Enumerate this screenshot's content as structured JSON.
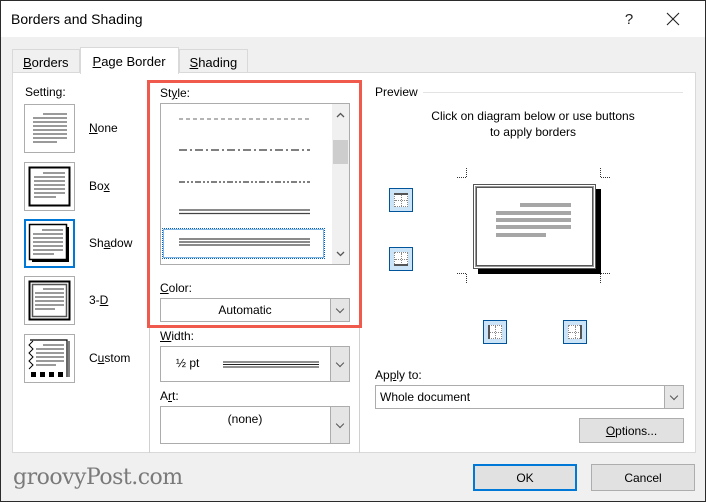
{
  "window": {
    "title": "Borders and Shading",
    "help_label": "?",
    "close_label": "✕"
  },
  "tabs": [
    {
      "label": "Borders",
      "accel": "B",
      "rest": "orders",
      "active": false
    },
    {
      "label": "Page Border",
      "accel": "P",
      "rest": "age Border",
      "active": true
    },
    {
      "label": "Shading",
      "accel": "S",
      "rest": "hading",
      "active": false
    }
  ],
  "setting": {
    "label": "Setting:",
    "items": [
      {
        "label": "None",
        "pre": "",
        "accel": "N",
        "post": "one",
        "selected": false,
        "icon": "page-no-border-icon"
      },
      {
        "label": "Box",
        "pre": "Bo",
        "accel": "x",
        "post": "",
        "selected": false,
        "icon": "page-box-border-icon"
      },
      {
        "label": "Shadow",
        "pre": "Sh",
        "accel": "a",
        "post": "dow",
        "selected": true,
        "icon": "page-shadow-border-icon"
      },
      {
        "label": "3-D",
        "pre": "3-",
        "accel": "D",
        "post": "",
        "selected": false,
        "icon": "page-3d-border-icon"
      },
      {
        "label": "Custom",
        "pre": "C",
        "accel": "u",
        "post": "stom",
        "selected": false,
        "icon": "page-custom-border-icon"
      }
    ]
  },
  "style": {
    "label_pre": "St",
    "label_accel": "y",
    "label_post": "le:",
    "options": [
      "dashed",
      "dash-dot",
      "dash-dot-dot",
      "double",
      "triple"
    ],
    "selected": "triple"
  },
  "color": {
    "label_accel": "C",
    "label_post": "olor:",
    "value": "Automatic"
  },
  "width": {
    "label_accel": "W",
    "label_post": "idth:",
    "value": "½ pt"
  },
  "art": {
    "label_pre": "A",
    "label_accel": "r",
    "label_post": "t:",
    "value": "(none)"
  },
  "preview": {
    "label": "Preview",
    "hint_line1": "Click on diagram below or use buttons",
    "hint_line2": "to apply borders"
  },
  "apply_to": {
    "label_pre": "Ap",
    "label_accel": "p",
    "label_post": "ly to:",
    "value": "Whole document"
  },
  "buttons": {
    "options_accel": "O",
    "options_rest": "ptions...",
    "ok": "OK",
    "cancel": "Cancel"
  },
  "watermark": "groovyPost.com",
  "colors": {
    "highlight": "#f05a4c",
    "accent": "#0078d7"
  }
}
